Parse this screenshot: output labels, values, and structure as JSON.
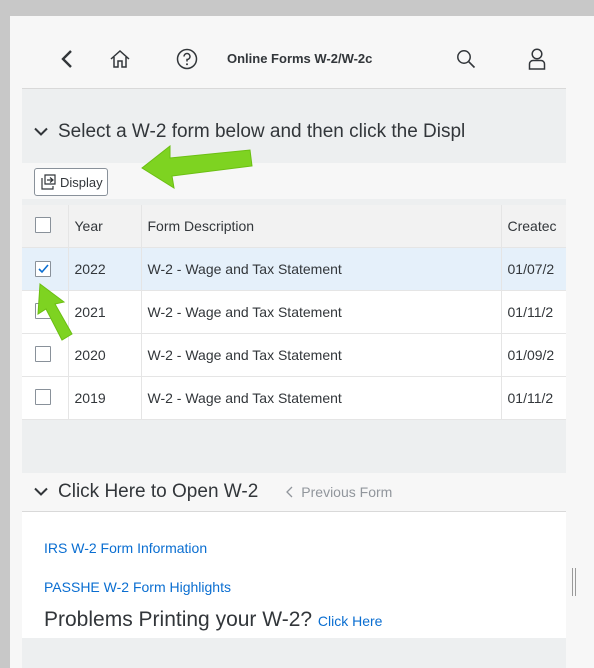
{
  "shellbar": {
    "title": "Online Forms W-2/W-2c"
  },
  "panel": {
    "instruction": "Select a W-2 form below and then click the Displ",
    "display_label": "Display"
  },
  "table": {
    "columns": [
      "Year",
      "Form Description",
      "Createc"
    ],
    "rows": [
      {
        "year": "2022",
        "description": "W-2 - Wage and Tax Statement",
        "created": "01/07/2",
        "checked": true
      },
      {
        "year": "2021",
        "description": "W-2 - Wage and Tax Statement",
        "created": "01/11/2",
        "checked": false
      },
      {
        "year": "2020",
        "description": "W-2 - Wage and Tax Statement",
        "created": "01/09/2",
        "checked": false
      },
      {
        "year": "2019",
        "description": "W-2 - Wage and Tax Statement",
        "created": "01/11/2",
        "checked": false
      }
    ]
  },
  "section2": {
    "title": "Click Here to Open W-2",
    "previous_label": "Previous Form",
    "links": [
      "IRS W-2 Form Information",
      "PASSHE W-2 Form Highlights"
    ],
    "problems_text": "Problems Printing your W-2?",
    "click_here": "Click Here"
  },
  "colors": {
    "link": "#0a6ed1",
    "arrow": "#7ed321",
    "selected_row": "#e5f0fa"
  }
}
